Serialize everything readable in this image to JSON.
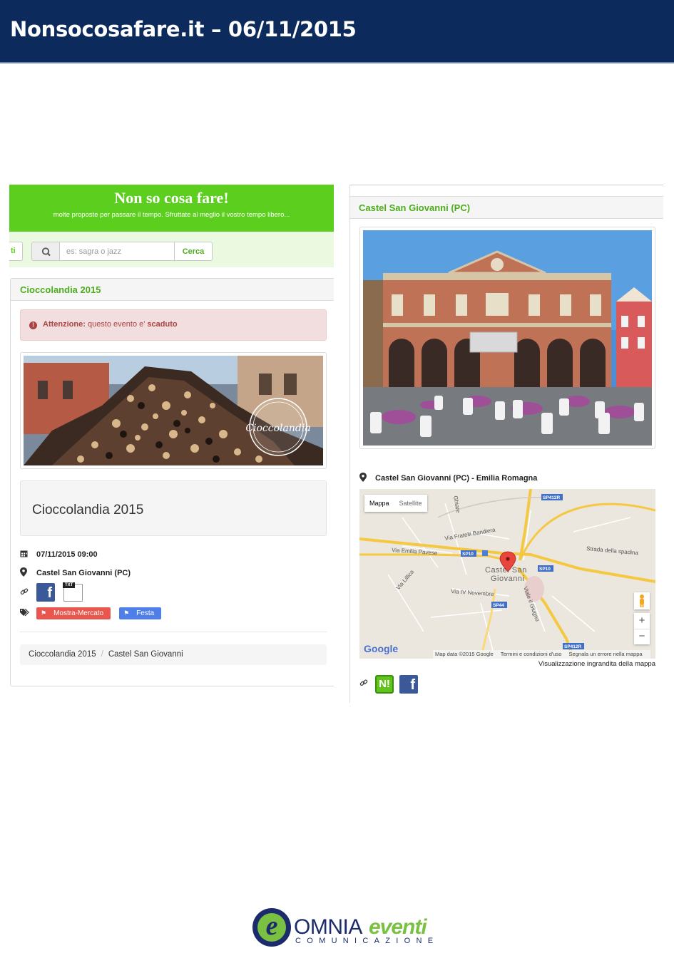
{
  "banner": {
    "title": "Nonsocosafare.it – 06/11/2015"
  },
  "left": {
    "site": {
      "title": "Non so cosa fare!",
      "subtitle": "molte proposte per passare il tempo. Sfruttate al meglio il vostro tempo libero..."
    },
    "search": {
      "prev_label": "ti",
      "placeholder": "es: sagra o jazz",
      "button": "Cerca"
    },
    "panel": {
      "title": "Cioccolandia 2015",
      "alert": {
        "label": "Attenzione:",
        "text": "questo evento e'",
        "status": "scaduto"
      },
      "image_watermark": "Cioccolandia",
      "well_title": "Cioccolandia 2015",
      "date": "07/11/2015 09:00",
      "place": "Castel San Giovanni (PC)",
      "doc_label": "TXT",
      "tags": [
        "Mostra-Mercato",
        "Festa"
      ],
      "breadcrumb": [
        "Cioccolandia 2015",
        "Castel San Giovanni"
      ],
      "breadcrumb_sep": "/"
    }
  },
  "right": {
    "panel_title": "Castel San Giovanni (PC)",
    "location": "Castel San Giovanni (PC) - Emilia Romagna",
    "map": {
      "tabs": [
        "Mappa",
        "Satellite"
      ],
      "town_label_1": "Castel San",
      "town_label_2": "Giovanni",
      "streets": [
        "Via Emilia Pavese",
        "Via Fratelli Bandiera",
        "Strada della spadina",
        "Via IV Novembre",
        "Viale il Giugno",
        "Via Lillica",
        "Ghiare"
      ],
      "road_badges": [
        "SP412R",
        "SP10",
        "SP10",
        "SP44",
        "SP412R"
      ],
      "zoom_in": "+",
      "zoom_out": "−",
      "google": "Google",
      "footer": [
        "Map data ©2015 Google",
        "Termini e condizioni d'uso",
        "Segnala un errore nella mappa"
      ]
    },
    "bigger_map": "Visualizzazione ingrandita della mappa",
    "share": {
      "nl_label": "N!",
      "fb_label": "f"
    }
  },
  "logo": {
    "omnia": "OMNIA",
    "eventi": "eventi",
    "sub": "COMUNICAZIONE",
    "e": "e"
  },
  "colors": {
    "banner": "#0d2a5c",
    "site_green": "#5ccf1e",
    "link_green": "#4dae1c",
    "alert_text": "#a94442",
    "tag_red": "#e8564d",
    "tag_blue": "#4e7fe9",
    "facebook": "#3b5998"
  }
}
